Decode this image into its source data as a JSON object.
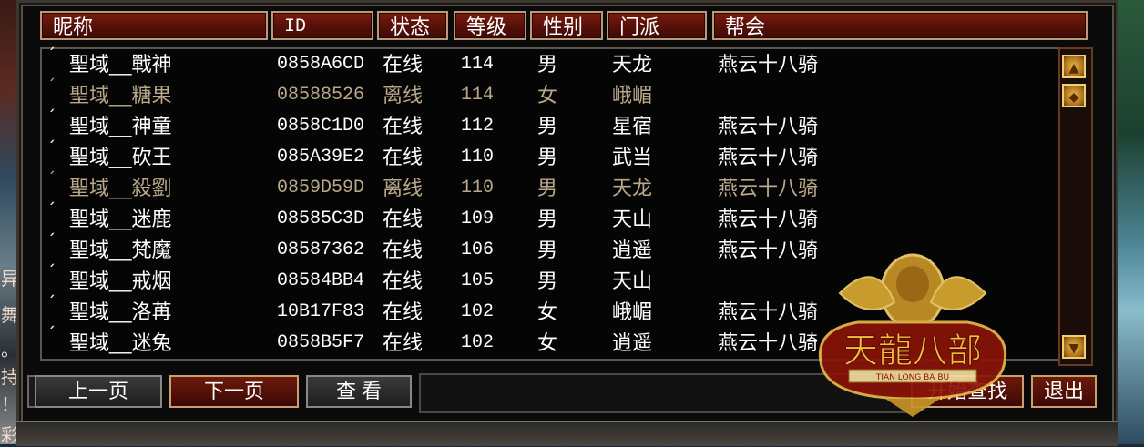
{
  "columns": [
    "昵称",
    "ID",
    "状态",
    "等级",
    "性别",
    "门派",
    "帮会"
  ],
  "rows": [
    {
      "name": "聖域__戰神",
      "id": "0858A6CD",
      "status": "在线",
      "level": "114",
      "gender": "男",
      "school": "天龙",
      "guild": "燕云十八骑",
      "offline": false
    },
    {
      "name": "聖域__糖果",
      "id": "08588526",
      "status": "离线",
      "level": "114",
      "gender": "女",
      "school": "峨嵋",
      "guild": "",
      "offline": true
    },
    {
      "name": "聖域__神童",
      "id": "0858C1D0",
      "status": "在线",
      "level": "112",
      "gender": "男",
      "school": "星宿",
      "guild": "燕云十八骑",
      "offline": false
    },
    {
      "name": "聖域__砍王",
      "id": "085A39E2",
      "status": "在线",
      "level": "110",
      "gender": "男",
      "school": "武当",
      "guild": "燕云十八骑",
      "offline": false
    },
    {
      "name": "聖域__殺劉",
      "id": "0859D59D",
      "status": "离线",
      "level": "110",
      "gender": "男",
      "school": "天龙",
      "guild": "燕云十八骑",
      "offline": true
    },
    {
      "name": "聖域__迷鹿",
      "id": "08585C3D",
      "status": "在线",
      "level": "109",
      "gender": "男",
      "school": "天山",
      "guild": "燕云十八骑",
      "offline": false
    },
    {
      "name": "聖域__梵魔",
      "id": "08587362",
      "status": "在线",
      "level": "106",
      "gender": "男",
      "school": "逍遥",
      "guild": "燕云十八骑",
      "offline": false
    },
    {
      "name": "聖域__戒烟",
      "id": "08584BB4",
      "status": "在线",
      "level": "105",
      "gender": "男",
      "school": "天山",
      "guild": "",
      "offline": false
    },
    {
      "name": "聖域__洛苒",
      "id": "10B17F83",
      "status": "在线",
      "level": "102",
      "gender": "女",
      "school": "峨嵋",
      "guild": "燕云十八骑",
      "offline": false
    },
    {
      "name": "聖域__迷兔",
      "id": "0858B5F7",
      "status": "在线",
      "level": "102",
      "gender": "女",
      "school": "逍遥",
      "guild": "燕云十八骑",
      "offline": false
    }
  ],
  "row_marker": "ˊ",
  "buttons": {
    "prev_page": "上一页",
    "next_page": "下一页",
    "view": "查 看",
    "start_search": "开始查找",
    "exit": "退出"
  },
  "scroll": {
    "up_icon": "chevron-up-icon",
    "thumb_icon": "scroll-thumb-icon",
    "down_icon": "chevron-down-icon"
  },
  "emblem": {
    "title": "天龍八部",
    "subtitle": "TIAN LONG BA BU"
  },
  "scene_left_glyphs": [
    "异",
    "舞",
    "。",
    "持",
    "！",
    "彩"
  ],
  "colors": {
    "online_text": "#ffffff",
    "offline_text": "#b9a98a",
    "header_bg": "#5c120a",
    "emblem_gold": "#d8a830",
    "emblem_red": "#8a1408"
  }
}
